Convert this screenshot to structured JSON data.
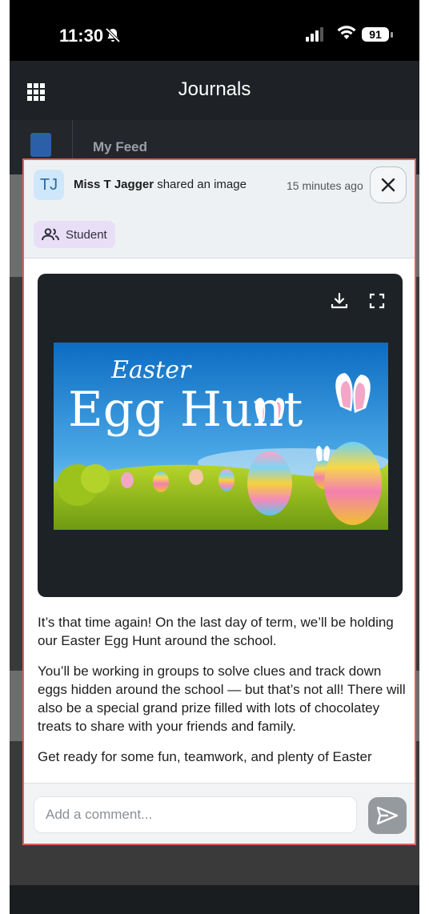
{
  "status": {
    "time": "11:30",
    "battery": "91"
  },
  "appbar": {
    "title": "Journals"
  },
  "feed": {
    "label": "My Feed"
  },
  "post": {
    "avatar_initials": "TJ",
    "author": "Miss T Jagger",
    "action": " shared an image",
    "time": "15 minutes ago",
    "audience_chip": "Student",
    "image": {
      "title_small": "Easter",
      "title_large": "Egg Hunt"
    },
    "paragraphs": [
      "It’s that time again! On the last day of term, we’ll be holding our Easter Egg Hunt around the school.",
      "You’ll be working in groups to solve clues and track down eggs hidden around the school — but that’s not all! There will also be a special grand prize filled with lots of chocolatey treats to share with your friends and family.",
      "Get ready for some fun, teamwork, and plenty of Easter"
    ]
  },
  "comment": {
    "placeholder": "Add a comment..."
  },
  "colors": {
    "modal_border": "#e35d5a",
    "chip_bg": "#e8dff7",
    "avatar_bg": "#cfe7fb"
  }
}
